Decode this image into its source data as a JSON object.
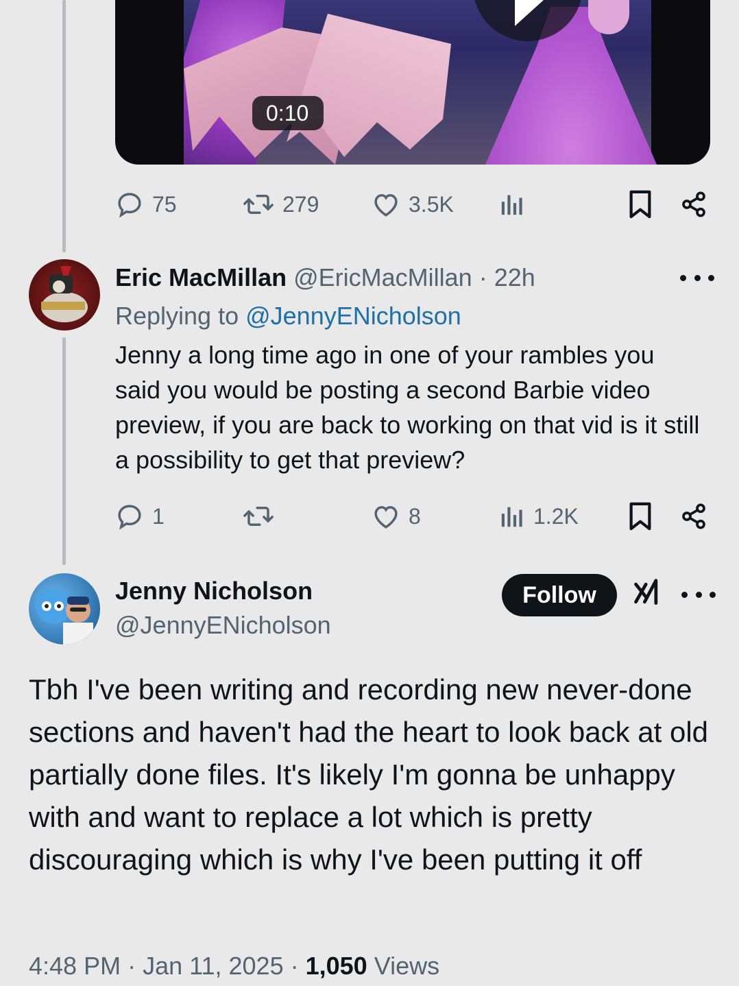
{
  "video": {
    "duration": "0:10"
  },
  "original_tweet_actions": {
    "replies": "75",
    "reposts": "279",
    "likes": "3.5K",
    "views": ""
  },
  "reply_tweet": {
    "author_name": "Eric MacMillan",
    "handle": "@EricMacMillan",
    "separator": " · ",
    "time": "22h",
    "replying_prefix": "Replying to ",
    "replying_to": "@JennyENicholson",
    "text": "Jenny a long time ago in one of your rambles you said you would be posting a second Barbie video preview, if you are back to working on that vid is it still a possibility to get that preview?",
    "actions": {
      "replies": "1",
      "reposts": "",
      "likes": "8",
      "views": "1.2K"
    }
  },
  "main_tweet": {
    "author_name": "Jenny Nicholson",
    "handle": "@JennyENicholson",
    "follow_label": "Follow",
    "text": "Tbh I've been writing and recording new never-done sections and haven't had the heart to look back at old partially done files. It's likely I'm gonna be unhappy with and want to replace a lot which is pretty discouraging which is why I've been putting it off",
    "time": "4:48 PM",
    "date": "Jan 11, 2025",
    "separator": " · ",
    "views_count": "1,050",
    "views_label": "Views"
  },
  "icons": [
    "reply-icon",
    "repost-icon",
    "like-icon",
    "views-icon",
    "bookmark-icon",
    "share-icon",
    "more-icon",
    "grok-icon",
    "play-icon"
  ],
  "colors": {
    "background": "#e9e9ea",
    "text": "#0f1419",
    "muted": "#536471",
    "link": "#1d6fa5",
    "thread_line": "#b8bcc0"
  }
}
